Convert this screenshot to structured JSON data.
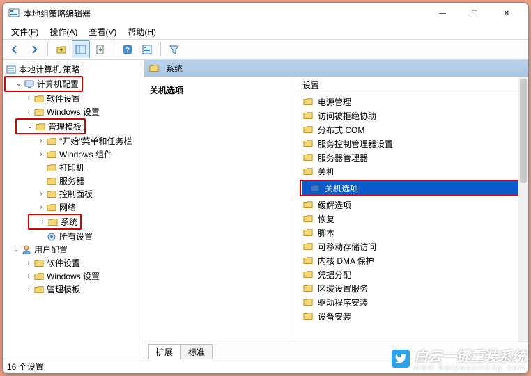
{
  "window": {
    "title": "本地组策略编辑器",
    "min": "—",
    "max": "☐",
    "close": "✕"
  },
  "menus": {
    "file": "文件(F)",
    "action": "操作(A)",
    "view": "查看(V)",
    "help": "帮助(H)"
  },
  "tree": {
    "root": "本地计算机 策略",
    "computer_config": "计算机配置",
    "cc_software": "软件设置",
    "cc_windows": "Windows 设置",
    "cc_admin_templates": "管理模板",
    "at_startmenu": "\"开始\"菜单和任务栏",
    "at_windows_components": "Windows 组件",
    "at_printers": "打印机",
    "at_server": "服务器",
    "at_control_panel": "控制面板",
    "at_network": "网络",
    "at_system": "系统",
    "at_all_settings": "所有设置",
    "user_config": "用户配置",
    "uc_software": "软件设置",
    "uc_windows": "Windows 设置",
    "uc_admin_templates": "管理模板"
  },
  "right": {
    "header": "系统",
    "heading": "关机选项",
    "col_setting": "设置",
    "items": [
      "电源管理",
      "访问被拒绝协助",
      "分布式 COM",
      "服务控制管理器设置",
      "服务器管理器",
      "关机",
      "关机选项",
      "缓解选项",
      "恢复",
      "脚本",
      "可移动存储访问",
      "内核 DMA 保护",
      "凭据分配",
      "区域设置服务",
      "驱动程序安装",
      "设备安装"
    ],
    "selected_index": 6
  },
  "tabs": {
    "extended": "扩展",
    "standard": "标准"
  },
  "status": "16 个设置",
  "watermark": {
    "main": "白云一键重装系统",
    "sub": "www.baiyunxitong.com"
  }
}
